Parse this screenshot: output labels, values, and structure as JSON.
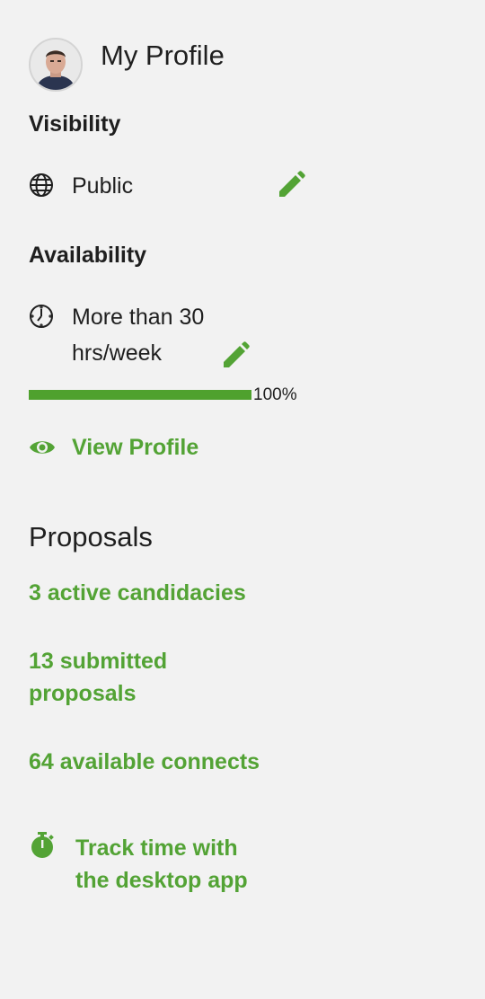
{
  "profile": {
    "title": "My Profile",
    "avatar_alt": "avatar"
  },
  "visibility": {
    "heading": "Visibility",
    "value": "Public",
    "icon": "globe-icon",
    "edit_icon": "pencil-icon"
  },
  "availability": {
    "heading": "Availability",
    "value_line1": "More than 30",
    "value_line2": "hrs/week",
    "icon": "clock-icon",
    "edit_icon": "pencil-icon",
    "profile_completeness_percent": 100,
    "profile_completeness_label": "100%"
  },
  "view_profile": {
    "label": "View Profile",
    "icon": "eye-icon"
  },
  "proposals": {
    "heading": "Proposals",
    "active_candidacies": "3 active candidacies",
    "submitted_line1": "13 submitted",
    "submitted_line2": "proposals",
    "available_connects": "64 available connects"
  },
  "track_time": {
    "line1": "Track time with",
    "line2": "the desktop app",
    "icon": "stopwatch-icon"
  },
  "colors": {
    "accent": "#53a335",
    "background": "#f2f2f2",
    "text": "#1f1f1f"
  }
}
